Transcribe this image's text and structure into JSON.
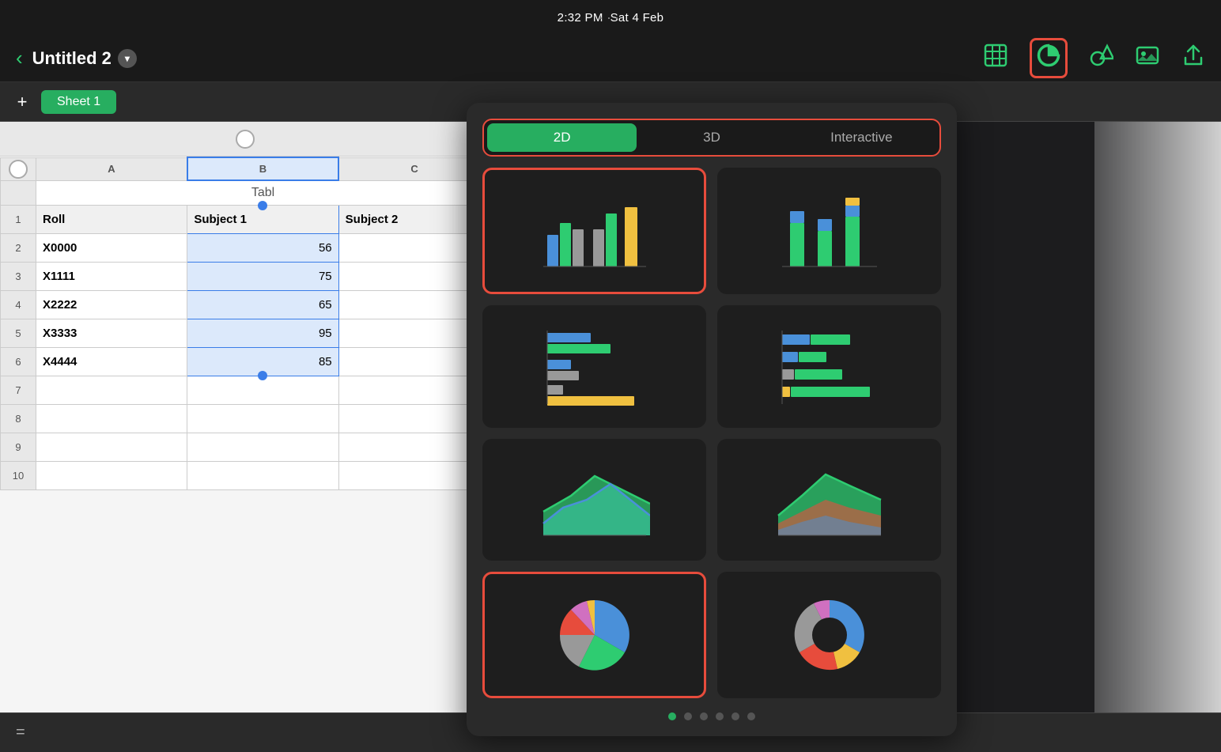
{
  "statusBar": {
    "time": "2:32 PM",
    "date": "Sat 4 Feb",
    "dots": "···"
  },
  "titleBar": {
    "backLabel": "‹",
    "documentTitle": "Untitled 2",
    "dropdownArrow": "▾",
    "icons": {
      "table": "table-icon",
      "chart": "chart-icon",
      "shapes": "shapes-icon",
      "media": "media-icon",
      "share": "share-icon"
    }
  },
  "sheetBar": {
    "addLabel": "+",
    "sheetName": "Sheet 1"
  },
  "spreadsheet": {
    "columns": [
      "A",
      "B",
      "C"
    ],
    "tableTitle": "Table",
    "headers": [
      "Roll",
      "Subject 1",
      "Subject 2"
    ],
    "rows": [
      {
        "roll": "X0000",
        "s1": "56",
        "s2": ""
      },
      {
        "roll": "X1111",
        "s1": "75",
        "s2": ""
      },
      {
        "roll": "X2222",
        "s1": "65",
        "s2": ""
      },
      {
        "roll": "X3333",
        "s1": "95",
        "s2": ""
      },
      {
        "roll": "X4444",
        "s1": "85",
        "s2": ""
      }
    ],
    "emptyRows": [
      7,
      8,
      9,
      10
    ]
  },
  "chartPanel": {
    "tabs": [
      "2D",
      "3D",
      "Interactive"
    ],
    "activeTab": 0,
    "chartTypes": [
      {
        "id": "bar-grouped",
        "label": "Grouped Bar",
        "selected": true
      },
      {
        "id": "bar-stacked",
        "label": "Stacked Bar",
        "selected": false
      },
      {
        "id": "bar-horizontal-grouped",
        "label": "Horizontal Grouped",
        "selected": false
      },
      {
        "id": "bar-horizontal-stacked",
        "label": "Horizontal Stacked",
        "selected": false
      },
      {
        "id": "area-filled",
        "label": "Area",
        "selected": false
      },
      {
        "id": "area-outlined",
        "label": "Area Outlined",
        "selected": false
      },
      {
        "id": "pie",
        "label": "Pie",
        "selected": true
      },
      {
        "id": "donut",
        "label": "Donut",
        "selected": false
      }
    ],
    "paginationDots": 6,
    "activeDot": 0
  }
}
